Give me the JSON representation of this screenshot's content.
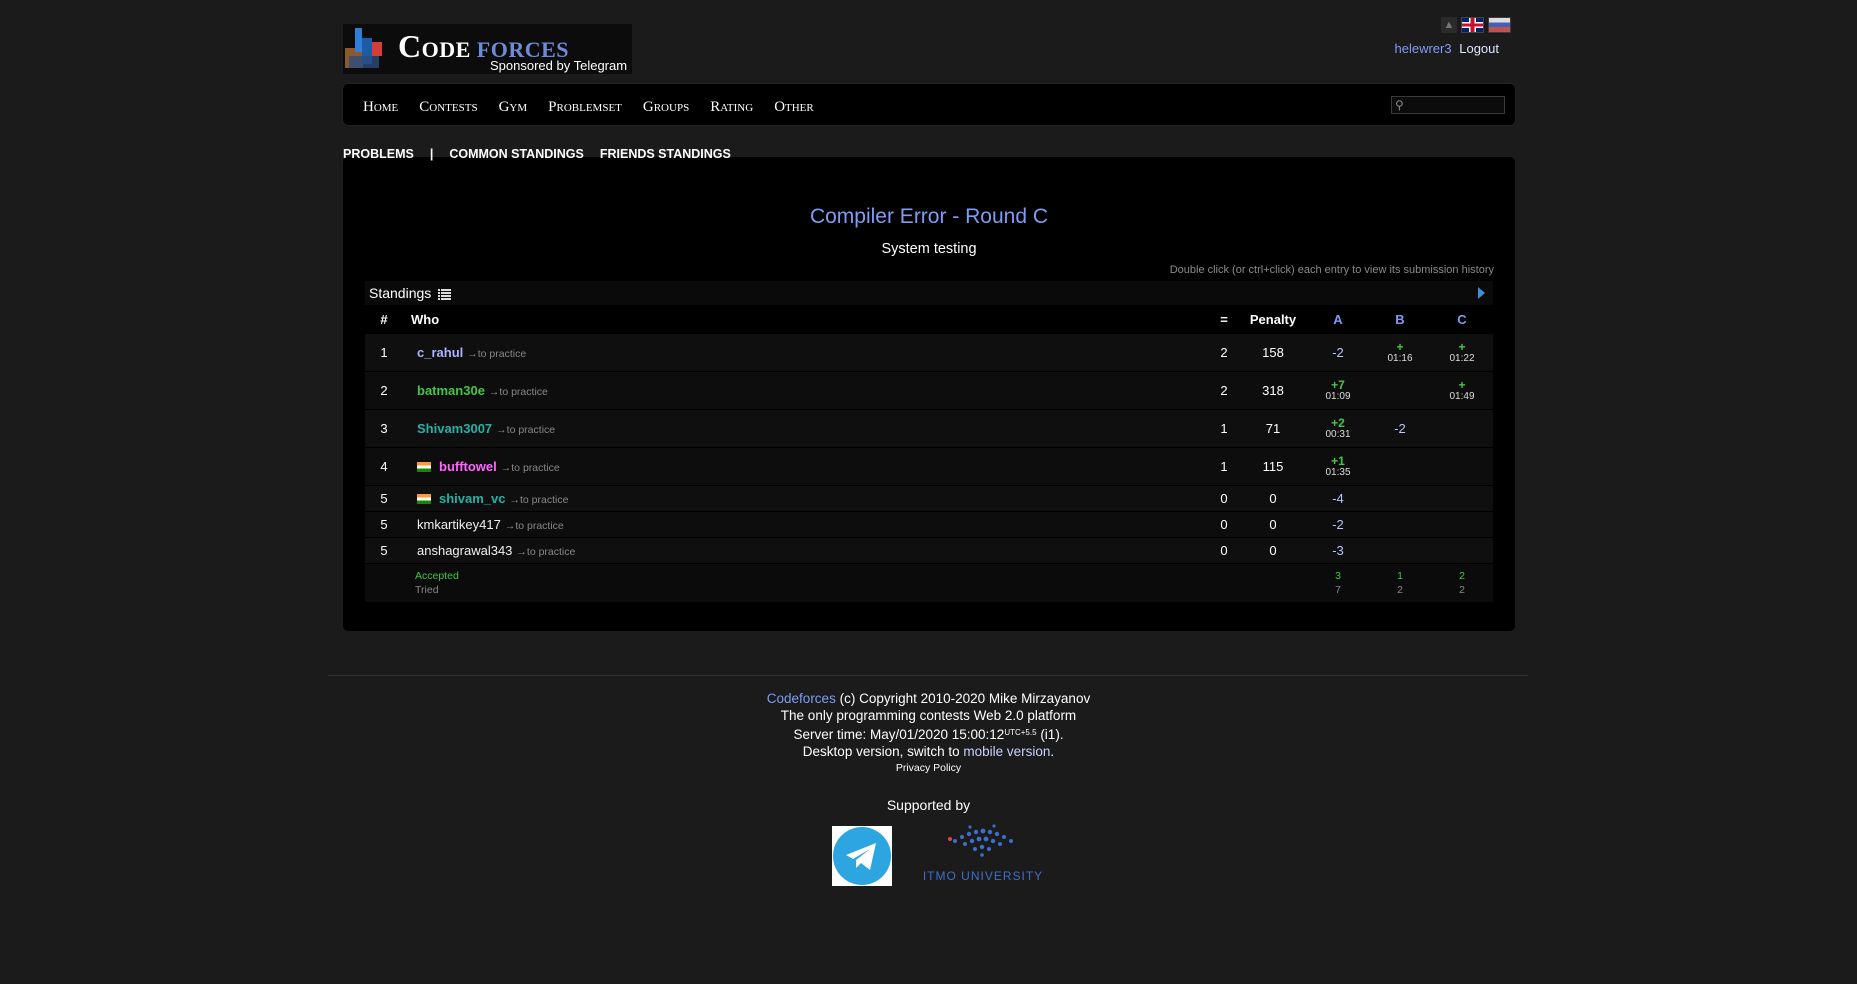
{
  "header": {
    "logo_word1": "Code",
    "logo_word2": "forces",
    "sponsor": "Sponsored by Telegram",
    "username": "helewrer3",
    "logout": "Logout"
  },
  "menu": {
    "items": [
      "Home",
      "Contests",
      "Gym",
      "Problemset",
      "Groups",
      "Rating",
      "Other"
    ],
    "search_value": ""
  },
  "subnav": {
    "problems": "PROBLEMS",
    "separator": "|",
    "common": "COMMON STANDINGS",
    "friends": "FRIENDS STANDINGS"
  },
  "contest": {
    "title": "Compiler Error - Round C",
    "status": "System testing",
    "hint": "Double click (or ctrl+click) each entry to view its submission history"
  },
  "standings": {
    "title": "Standings",
    "columns": {
      "rank": "#",
      "who": "Who",
      "solved": "=",
      "penalty": "Penalty",
      "a": "A",
      "b": "B",
      "c": "C"
    },
    "practice_label": "→to practice",
    "rows": [
      {
        "rank": "1",
        "handle": "c_rahul",
        "solved": "2",
        "penalty": "158",
        "a_main": "-2",
        "a_time": "",
        "b_main": "+",
        "b_time": "01:16",
        "c_main": "+",
        "c_time": "01:22"
      },
      {
        "rank": "2",
        "handle": "batman30e",
        "solved": "2",
        "penalty": "318",
        "a_main": "+7",
        "a_time": "01:09",
        "b_main": "",
        "b_time": "",
        "c_main": "+",
        "c_time": "01:49"
      },
      {
        "rank": "3",
        "handle": "Shivam3007",
        "solved": "1",
        "penalty": "71",
        "a_main": "+2",
        "a_time": "00:31",
        "b_main": "-2",
        "b_time": "",
        "c_main": "",
        "c_time": ""
      },
      {
        "rank": "4",
        "handle": "bufftowel",
        "solved": "1",
        "penalty": "115",
        "a_main": "+1",
        "a_time": "01:35",
        "b_main": "",
        "b_time": "",
        "c_main": "",
        "c_time": ""
      },
      {
        "rank": "5",
        "handle": "shivam_vc",
        "solved": "0",
        "penalty": "0",
        "a_main": "-4",
        "a_time": "",
        "b_main": "",
        "b_time": "",
        "c_main": "",
        "c_time": ""
      },
      {
        "rank": "5",
        "handle": "kmkartikey417",
        "solved": "0",
        "penalty": "0",
        "a_main": "-2",
        "a_time": "",
        "b_main": "",
        "b_time": "",
        "c_main": "",
        "c_time": ""
      },
      {
        "rank": "5",
        "handle": "anshagrawal343",
        "solved": "0",
        "penalty": "0",
        "a_main": "-3",
        "a_time": "",
        "b_main": "",
        "b_time": "",
        "c_main": "",
        "c_time": ""
      }
    ],
    "summary": {
      "accepted_label": "Accepted",
      "tried_label": "Tried",
      "a_acc": "3",
      "a_try": "7",
      "b_acc": "1",
      "b_try": "2",
      "c_acc": "2",
      "c_try": "2"
    }
  },
  "footer": {
    "codeforces_link": "Codeforces",
    "copyright": "(c) Copyright 2010-2020 Mike Mirzayanov",
    "tagline": "The only programming contests Web 2.0 platform",
    "server_time_prefix": "Server time: May/01/2020 15:00:12",
    "utc": "UTC+5.5",
    "server_suffix": "(i1).",
    "desktop_prefix": "Desktop version, switch to",
    "mobile_link": "mobile version",
    "desktop_suffix": ".",
    "privacy": "Privacy Policy",
    "supported_by": "Supported by",
    "itmo": "ITMO UNIVERSITY"
  },
  "colors": {
    "background": "#1b1b1b",
    "link_blue": "#7f9cf5",
    "accepted_green": "#43c745",
    "cyan_handle": "#22b3a6",
    "violet_handle": "#ff66ff"
  }
}
